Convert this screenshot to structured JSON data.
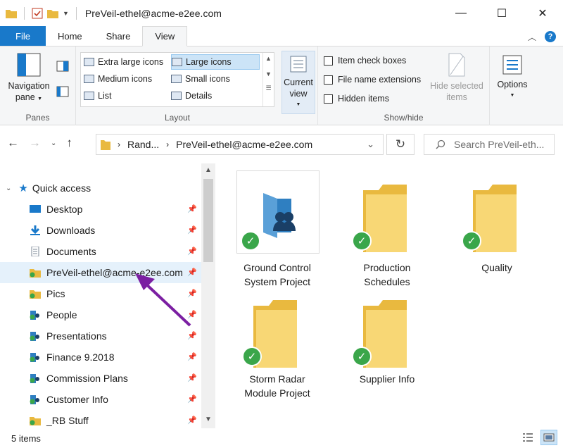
{
  "window": {
    "title": "PreVeil-ethel@acme-e2ee.com",
    "minimize": "—",
    "maximize": "☐",
    "close": "✕"
  },
  "ribbon_tabs": [
    "File",
    "Home",
    "Share",
    "View"
  ],
  "ribbon": {
    "panes": {
      "navigation_pane": "Navigation pane",
      "group_label": "Panes"
    },
    "layout": {
      "items": [
        "Extra large icons",
        "Large icons",
        "Medium icons",
        "Small icons",
        "List",
        "Details"
      ],
      "selected": "Large icons",
      "group_label": "Layout"
    },
    "current_view": {
      "label": "Current view"
    },
    "show_hide": {
      "item_check_boxes": "Item check boxes",
      "file_name_extensions": "File name extensions",
      "hidden_items": "Hidden items",
      "hide_selected_items": "Hide selected items",
      "group_label": "Show/hide"
    },
    "options": "Options"
  },
  "address": {
    "crumb1": "Rand...",
    "crumb2": "PreVeil-ethel@acme-e2ee.com",
    "search_placeholder": "Search PreVeil-eth..."
  },
  "nav": {
    "quick_access": "Quick access",
    "items": [
      {
        "label": "Desktop",
        "icon": "desktop-icon"
      },
      {
        "label": "Downloads",
        "icon": "downloads-icon"
      },
      {
        "label": "Documents",
        "icon": "documents-icon"
      },
      {
        "label": "PreVeil-ethel@acme-e2ee.com",
        "icon": "preveil-folder-icon"
      },
      {
        "label": "Pics",
        "icon": "preveil-folder-icon"
      },
      {
        "label": "People",
        "icon": "preveil-people-folder-icon"
      },
      {
        "label": "Presentations",
        "icon": "preveil-people-folder-icon"
      },
      {
        "label": "Finance 9.2018",
        "icon": "preveil-people-folder-icon"
      },
      {
        "label": "Commission Plans",
        "icon": "preveil-people-folder-icon"
      },
      {
        "label": "Customer Info",
        "icon": "preveil-people-folder-icon"
      },
      {
        "label": "_RB Stuff",
        "icon": "preveil-folder-icon"
      }
    ]
  },
  "content": {
    "items": [
      {
        "label_line1": "Ground Control",
        "label_line2": "System Project",
        "kind": "shared-folder-icon"
      },
      {
        "label_line1": "Production",
        "label_line2": "Schedules",
        "kind": "folder-icon"
      },
      {
        "label_line1": "Quality",
        "label_line2": "",
        "kind": "folder-icon"
      },
      {
        "label_line1": "Storm Radar",
        "label_line2": "Module Project",
        "kind": "folder-icon"
      },
      {
        "label_line1": "Supplier Info",
        "label_line2": "",
        "kind": "folder-icon"
      }
    ]
  },
  "status": {
    "item_count": "5 items"
  },
  "colors": {
    "accent": "#1979ca",
    "sync_green": "#3aa64a",
    "folder_yellow": "#f8d775",
    "annotation_arrow": "#7b1fa2",
    "selection": "#e5f1fb"
  }
}
